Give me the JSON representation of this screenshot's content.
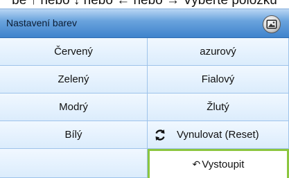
{
  "hint_text": "be ↑ nebo ↓ nebo ← nebo → Vyberte položku",
  "menu": {
    "title": "Nastavení barev",
    "title_icon": "image-settings-icon",
    "items": {
      "red": "Červený",
      "cyan": "azurový",
      "green": "Zelený",
      "magenta": "Fialový",
      "blue": "Modrý",
      "yellow": "Žlutý",
      "white": "Bílý",
      "reset": "Vynulovat (Reset)",
      "exit": "Vystoupit"
    }
  },
  "colors": {
    "header_blue": "#3f83cc",
    "cell_blue": "#dbecfc",
    "selection_green": "#8cc63f"
  }
}
